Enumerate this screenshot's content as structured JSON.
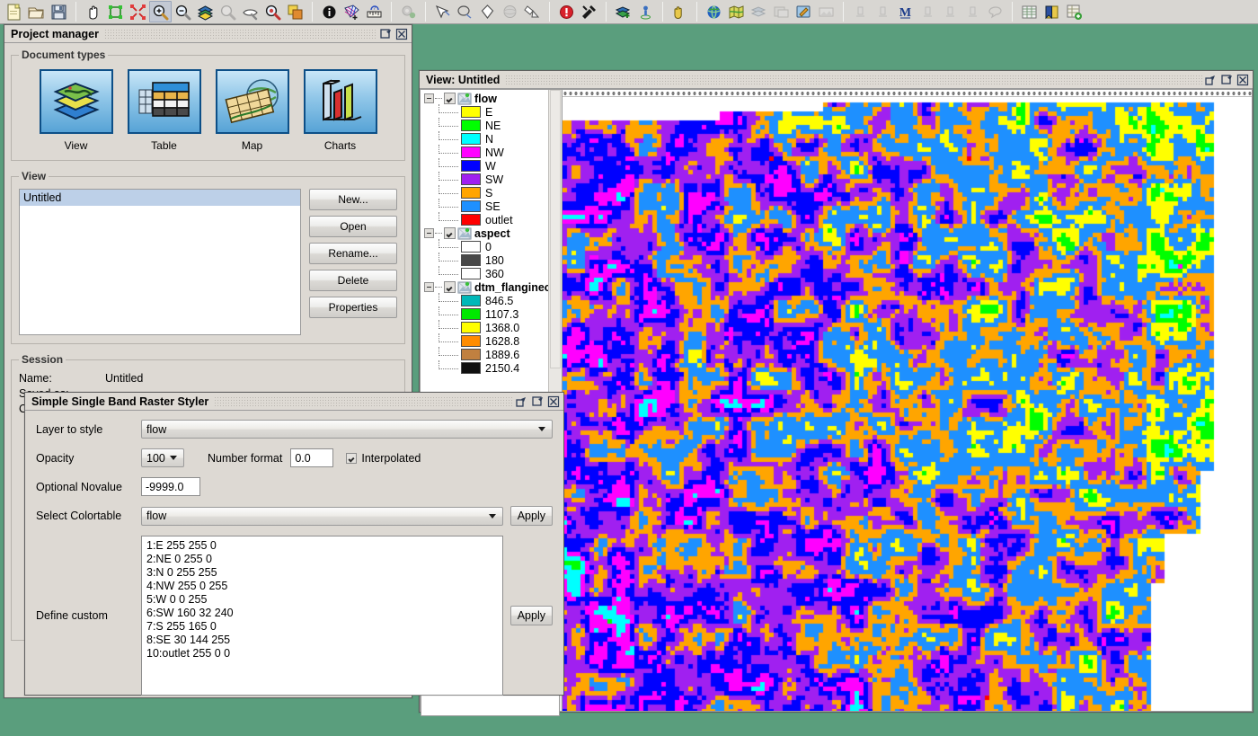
{
  "toolbar": {
    "groups": [
      {
        "name": "file",
        "buttons": [
          {
            "icon": "new-document-icon",
            "label": "New"
          },
          {
            "icon": "open-folder-icon",
            "label": "Open"
          },
          {
            "icon": "save-disk-icon",
            "label": "Save"
          }
        ]
      },
      {
        "name": "navigation",
        "buttons": [
          {
            "icon": "pan-hand-icon",
            "label": "Pan"
          },
          {
            "icon": "zoom-full-extent-icon",
            "label": "Zoom to full extent"
          },
          {
            "icon": "zoom-selection-icon",
            "label": "Zoom to selection"
          },
          {
            "icon": "zoom-in-icon",
            "label": "Zoom in",
            "selected": true
          },
          {
            "icon": "zoom-out-icon",
            "label": "Zoom out"
          },
          {
            "icon": "layers-icon",
            "label": "Layers"
          },
          {
            "icon": "zoom-previous-icon",
            "label": "Zoom previous"
          },
          {
            "icon": "zoom-next-icon",
            "label": "Zoom next"
          },
          {
            "icon": "zoom-layer-icon",
            "label": "Zoom to layer"
          },
          {
            "icon": "frame-icon",
            "label": "Frame"
          }
        ]
      },
      {
        "name": "info",
        "buttons": [
          {
            "icon": "info-icon",
            "label": "Info"
          },
          {
            "icon": "select-area-icon",
            "label": "Select by area"
          },
          {
            "icon": "measure-icon",
            "label": "Measure"
          }
        ]
      },
      {
        "name": "tools",
        "buttons": [
          {
            "icon": "geoprocess-gear-icon",
            "label": "Geoprocessing",
            "dim": true
          }
        ]
      },
      {
        "name": "selection",
        "buttons": [
          {
            "icon": "select-point-icon",
            "label": "Select by point"
          },
          {
            "icon": "select-lasso-icon",
            "label": "Select by lasso"
          },
          {
            "icon": "select-polygon-icon",
            "label": "Select by polygon"
          },
          {
            "icon": "select-sphere-icon",
            "label": "Select by sphere"
          },
          {
            "icon": "clear-selection-icon",
            "label": "Clear selection"
          }
        ]
      },
      {
        "name": "edit",
        "buttons": [
          {
            "icon": "stop-editing-icon",
            "label": "Stop editing"
          },
          {
            "icon": "editing-tools-icon",
            "label": "Editing tools"
          }
        ]
      },
      {
        "name": "layer",
        "buttons": [
          {
            "icon": "add-layer-icon",
            "label": "Add layer"
          },
          {
            "icon": "add-point-icon",
            "label": "Add point"
          }
        ]
      },
      {
        "name": "hand",
        "buttons": [
          {
            "icon": "hand-cursor-icon",
            "label": "Hand cursor"
          }
        ]
      },
      {
        "name": "web",
        "buttons": [
          {
            "icon": "globe-icon",
            "label": "Web map"
          },
          {
            "icon": "map-icon",
            "label": "Map"
          },
          {
            "icon": "wms-icon",
            "label": "WMS",
            "dim": true
          },
          {
            "icon": "catalog-icon",
            "label": "Catalog",
            "dim": true
          },
          {
            "icon": "edit-map-icon",
            "label": "Edit map"
          },
          {
            "icon": "image-icon",
            "label": "Image",
            "dim": true
          }
        ]
      },
      {
        "name": "annotation",
        "buttons": [
          {
            "icon": "text-tool-icon",
            "label": "Text tool",
            "dim": true
          },
          {
            "icon": "text-tool-2-icon",
            "label": "Text tool 2",
            "dim": true
          },
          {
            "icon": "bold-m-icon",
            "label": "M"
          },
          {
            "icon": "text-tool-3-icon",
            "label": "Text tool 3",
            "dim": true
          },
          {
            "icon": "text-tool-4-icon",
            "label": "Text tool 4",
            "dim": true
          },
          {
            "icon": "text-tool-5-icon",
            "label": "Text tool 5",
            "dim": true
          },
          {
            "icon": "balloon-icon",
            "label": "Balloon",
            "dim": true
          }
        ]
      },
      {
        "name": "tables",
        "buttons": [
          {
            "icon": "table-icon",
            "label": "Table"
          },
          {
            "icon": "bookmark-icon",
            "label": "Bookmark"
          },
          {
            "icon": "add-table-icon",
            "label": "Add table"
          }
        ]
      }
    ]
  },
  "project_manager": {
    "title": "Project manager",
    "window_buttons": [
      {
        "icon": "maximize-icon",
        "label": "Maximize"
      },
      {
        "icon": "close-icon",
        "label": "Close"
      }
    ],
    "document_types": {
      "legend": "Document types",
      "items": [
        {
          "label": "View",
          "icon": "view-layers-icon"
        },
        {
          "label": "Table",
          "icon": "table-grid-icon"
        },
        {
          "label": "Map",
          "icon": "map-globe-icon"
        },
        {
          "label": "Charts",
          "icon": "bar-chart-icon"
        }
      ]
    },
    "view": {
      "legend": "View",
      "list": [
        {
          "label": "Untitled",
          "selected": true
        }
      ],
      "buttons": [
        {
          "label": "New...",
          "name": "new-button"
        },
        {
          "label": "Open",
          "name": "open-button"
        },
        {
          "label": "Rename...",
          "name": "rename-button"
        },
        {
          "label": "Delete",
          "name": "delete-button"
        },
        {
          "label": "Properties",
          "name": "properties-button"
        }
      ]
    },
    "session": {
      "legend": "Session",
      "rows": [
        {
          "key": "Name:",
          "value": "Untitled"
        },
        {
          "key": "Saved as:",
          "value": ""
        },
        {
          "key": "C",
          "value": ""
        }
      ]
    }
  },
  "view_window": {
    "title": "View: Untitled",
    "window_buttons": [
      {
        "icon": "restore-icon",
        "label": "Restore"
      },
      {
        "icon": "maximize-icon",
        "label": "Maximize"
      },
      {
        "icon": "close-icon",
        "label": "Close"
      }
    ],
    "layers": [
      {
        "name": "flow",
        "checked": true,
        "expanded": true,
        "entries": [
          {
            "label": "E",
            "color": "#ffff00"
          },
          {
            "label": "NE",
            "color": "#00ff00"
          },
          {
            "label": "N",
            "color": "#00ffff"
          },
          {
            "label": "NW",
            "color": "#ff00ff"
          },
          {
            "label": "W",
            "color": "#0000ff"
          },
          {
            "label": "SW",
            "color": "#a020f0"
          },
          {
            "label": "S",
            "color": "#ffa500"
          },
          {
            "label": "SE",
            "color": "#1e90ff"
          },
          {
            "label": "outlet",
            "color": "#ff0000"
          }
        ]
      },
      {
        "name": "aspect",
        "checked": true,
        "expanded": true,
        "entries": [
          {
            "label": "0",
            "color": "#ffffff"
          },
          {
            "label": "180",
            "color": "#484848"
          },
          {
            "label": "360",
            "color": "#ffffff"
          }
        ]
      },
      {
        "name": "dtm_flanginec",
        "checked": true,
        "expanded": true,
        "entries": [
          {
            "label": "846.5",
            "color": "#00b8b8"
          },
          {
            "label": "1107.3",
            "color": "#00e800"
          },
          {
            "label": "1368.0",
            "color": "#ffff00"
          },
          {
            "label": "1628.8",
            "color": "#ff8c00"
          },
          {
            "label": "1889.6",
            "color": "#c08040"
          },
          {
            "label": "2150.4",
            "color": "#101010"
          }
        ]
      }
    ]
  },
  "styler": {
    "title": "Simple Single Band Raster Styler",
    "window_buttons": [
      {
        "icon": "restore-icon",
        "label": "Restore"
      },
      {
        "icon": "maximize-icon",
        "label": "Maximize"
      },
      {
        "icon": "close-icon",
        "label": "Close"
      }
    ],
    "layer_to_style": {
      "label": "Layer to style",
      "value": "flow"
    },
    "opacity": {
      "label": "Opacity",
      "value": "100"
    },
    "number_format": {
      "label": "Number format",
      "value": "0.0"
    },
    "interpolated": {
      "label": "Interpolated",
      "checked": true
    },
    "optional_novalue": {
      "label": "Optional Novalue",
      "value": "-9999.0"
    },
    "select_colortable": {
      "label": "Select Colortable",
      "value": "flow"
    },
    "apply_colortable_label": "Apply",
    "define_custom": {
      "label": "Define custom",
      "value": "1:E 255 255 0\n2:NE 0 255 0\n3:N 0 255 255\n4:NW 255 0 255\n5:W 0 0 255\n6:SW 160 32 240\n7:S 255 165 0\n8:SE 30 144 255\n10:outlet 255 0 0"
    },
    "apply_custom_label": "Apply"
  },
  "desktop": {
    "background_color": "#5a9e7d"
  }
}
